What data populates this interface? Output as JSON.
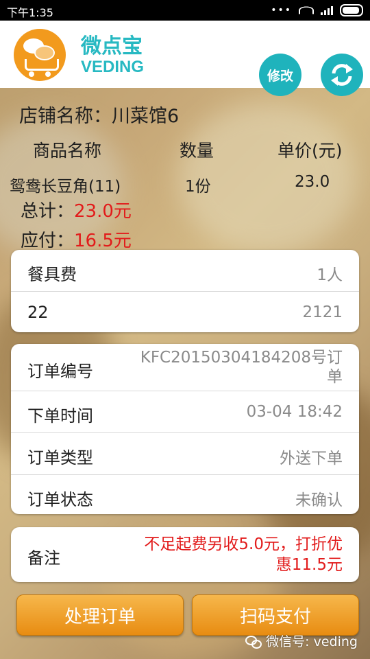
{
  "status_bar": {
    "time": "下午1:35"
  },
  "header": {
    "brand_cn": "微点宝",
    "brand_en": "VEDING",
    "edit_label": "修改",
    "icons": [
      "logo-cart-chat-icon",
      "refresh-icon"
    ]
  },
  "shop": {
    "label": "店铺名称：川菜馆6"
  },
  "items_table": {
    "headers": [
      "商品名称",
      "数量",
      "单价(元)"
    ],
    "rows": [
      {
        "name": "鸳鸯长豆角(11)",
        "qty": "1份",
        "price": "23.0"
      }
    ]
  },
  "summary": {
    "total_label": "总计：",
    "total_value": "23.0元",
    "pay_label": "应付：",
    "pay_value": "16.5元"
  },
  "fees_card": [
    {
      "label": "餐具费",
      "value": "1人"
    },
    {
      "label": "22",
      "value": "2121"
    }
  ],
  "order_card": [
    {
      "label": "订单编号",
      "value_line1": "KFC20150304184208号订",
      "value_line2": "单"
    },
    {
      "label": "下单时间",
      "value": "03-04 18:42"
    },
    {
      "label": "订单类型",
      "value": "外送下单"
    },
    {
      "label": "订单状态",
      "value": "未确认"
    }
  ],
  "remark_card": {
    "label": "备注",
    "value_line1": "不足起费另收5.0元，打折优",
    "value_line2": "惠11.5元"
  },
  "buttons": {
    "process": "处理订单",
    "scan_pay": "扫码支付"
  },
  "watermark": {
    "text": "微信号: veding"
  },
  "colors": {
    "accent_teal": "#1fb3bc",
    "brand_orange": "#f29a1d",
    "price_red": "#e21b1b",
    "button_orange": "#e88c12"
  }
}
